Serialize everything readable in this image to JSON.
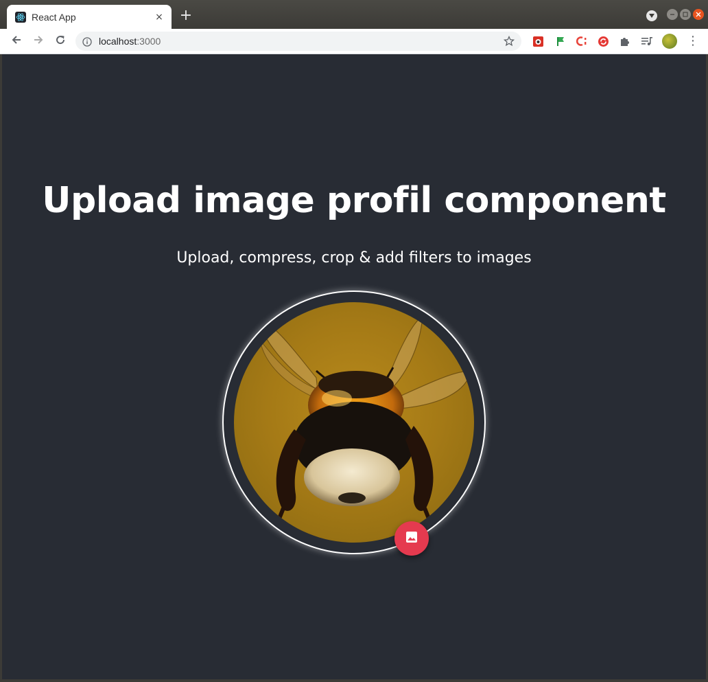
{
  "browser": {
    "tab_title": "React App",
    "tab_close": "×",
    "new_tab": "+",
    "url_host": "localhost",
    "url_port": ":3000",
    "menu": "⋮"
  },
  "page": {
    "title": "Upload image profil component",
    "subtitle": "Upload, compress, crop & add filters to images"
  },
  "icons": {
    "back": "arrow-left-icon",
    "forward": "arrow-right-icon",
    "reload": "reload-icon",
    "info": "info-icon",
    "bookmark": "star-icon",
    "upload": "image-icon"
  },
  "colors": {
    "background": "#282c34",
    "accent": "#e53a4f",
    "text": "#ffffff"
  }
}
